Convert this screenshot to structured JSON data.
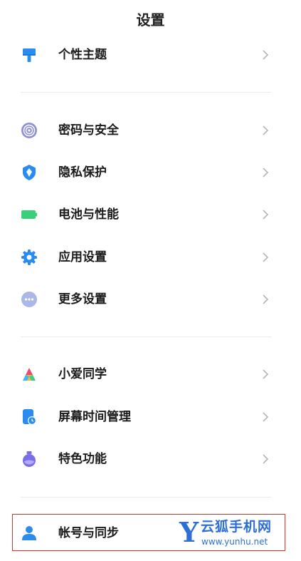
{
  "header": {
    "title": "设置"
  },
  "groups": [
    {
      "items": [
        {
          "label": "个性主题",
          "icon": "theme-brush-icon"
        }
      ]
    },
    {
      "items": [
        {
          "label": "密码与安全",
          "icon": "fingerprint-icon"
        },
        {
          "label": "隐私保护",
          "icon": "privacy-shield-icon"
        },
        {
          "label": "电池与性能",
          "icon": "battery-icon"
        },
        {
          "label": "应用设置",
          "icon": "app-gear-icon"
        },
        {
          "label": "更多设置",
          "icon": "more-dots-icon"
        }
      ]
    },
    {
      "items": [
        {
          "label": "小爱同学",
          "icon": "xiaoai-icon"
        },
        {
          "label": "屏幕时间管理",
          "icon": "screen-time-icon"
        },
        {
          "label": "特色功能",
          "icon": "features-flask-icon"
        }
      ]
    },
    {
      "items": [
        {
          "label": "帐号与同步",
          "icon": "account-person-icon"
        }
      ]
    }
  ],
  "watermark": {
    "letter": "Y",
    "name": "云狐手机网",
    "url": "www.yunhu.net"
  },
  "colors": {
    "accent": "#2a8cf0",
    "highlight": "#d9302a",
    "watermark": "#2e6fd6",
    "battery": "#3ccf7a"
  }
}
